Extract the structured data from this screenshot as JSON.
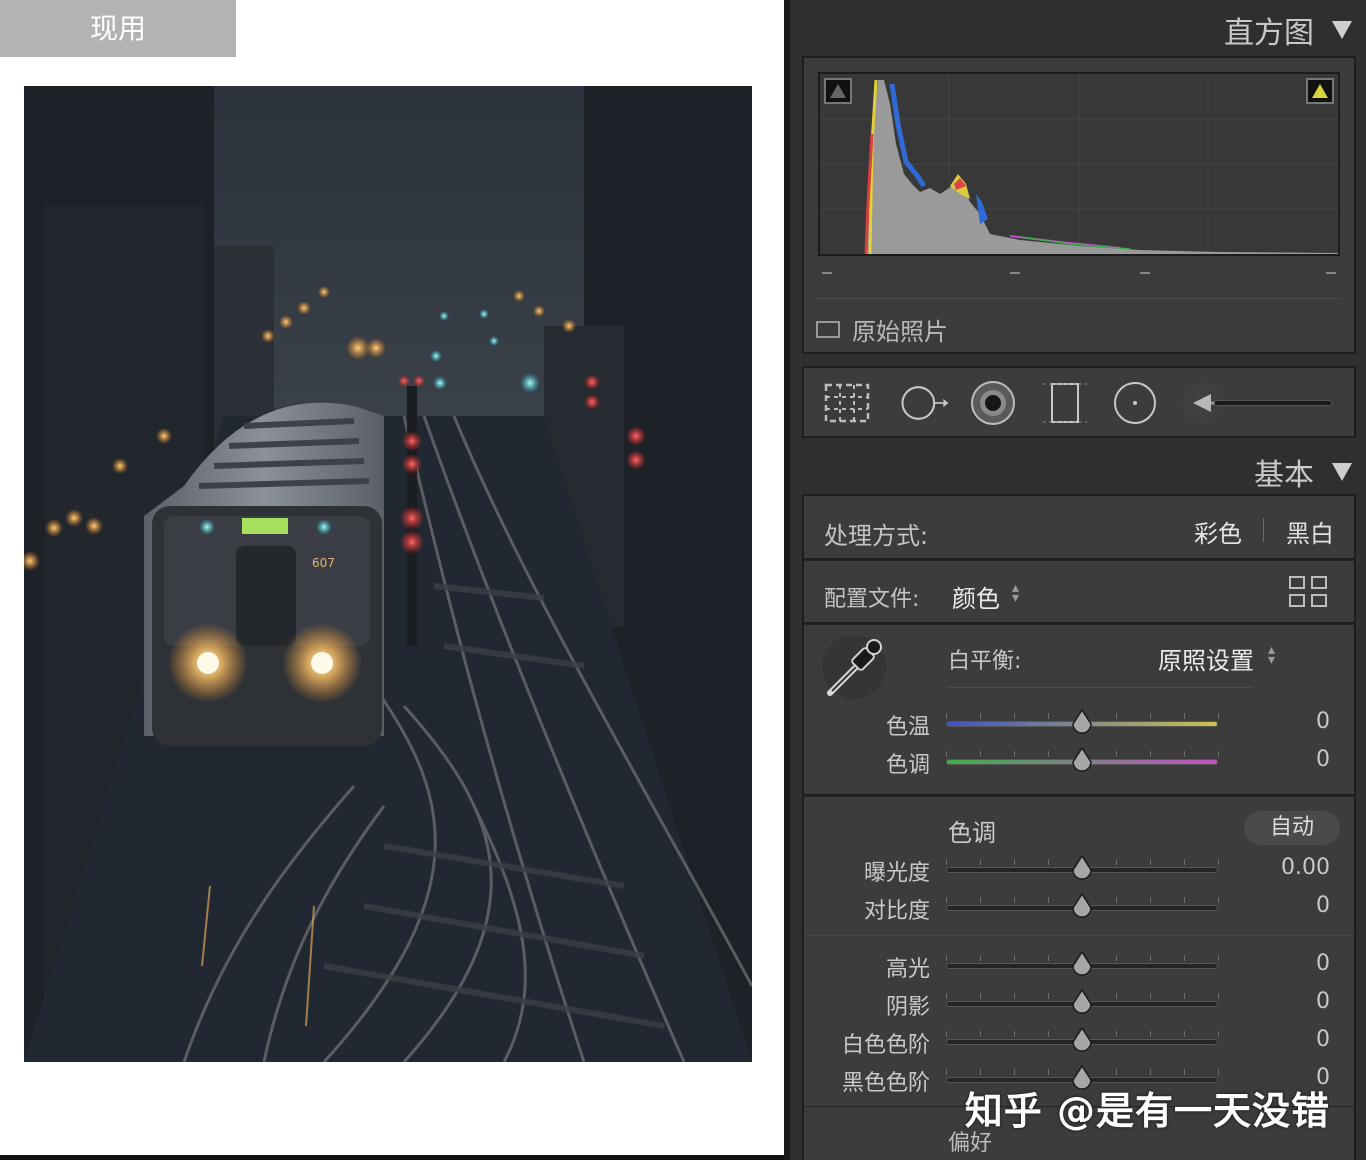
{
  "viewer": {
    "label": "现用"
  },
  "histogram": {
    "title": "直方图",
    "original_photo_label": "原始照片"
  },
  "tools": {
    "items": [
      "crop-overlay",
      "spot-removal",
      "red-eye",
      "graduated-filter",
      "radial-filter",
      "adjustment-brush"
    ]
  },
  "basic": {
    "title": "基本",
    "treatment_label": "处理方式:",
    "treatment_color": "彩色",
    "treatment_bw": "黑白",
    "profile_label": "配置文件:",
    "profile_value": "颜色",
    "wb_label": "白平衡:",
    "wb_value": "原照设置",
    "tone_label": "色调",
    "auto_label": "自动",
    "preferences_label": "偏好"
  },
  "sliders": {
    "temp": {
      "label": "色温",
      "value": "0"
    },
    "tint": {
      "label": "色调",
      "value": "0"
    },
    "exposure": {
      "label": "曝光度",
      "value": "0.00"
    },
    "contrast": {
      "label": "对比度",
      "value": "0"
    },
    "highlights": {
      "label": "高光",
      "value": "0"
    },
    "shadows": {
      "label": "阴影",
      "value": "0"
    },
    "whites": {
      "label": "白色色阶",
      "value": "0"
    },
    "blacks": {
      "label": "黑色色阶",
      "value": "0"
    }
  },
  "watermark": "知乎 @是有一天没错",
  "colors": {
    "panel_bg": "#2f2f2f",
    "section_bg": "#3c3c3c",
    "temp_gradient": [
      "#3f52c8",
      "#c9c24a"
    ],
    "tint_gradient": [
      "#3fb04a",
      "#c650c8"
    ]
  }
}
